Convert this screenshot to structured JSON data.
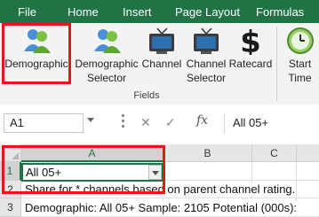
{
  "tabs": [
    "File",
    "Home",
    "Insert",
    "Page Layout",
    "Formulas"
  ],
  "ribbon": {
    "buttons": [
      {
        "line1": "Demographic",
        "line2": "",
        "icon": "demographic-people-icon"
      },
      {
        "line1": "Demographic",
        "line2": "Selector",
        "icon": "demographic-selector-icon"
      },
      {
        "line1": "Channel",
        "line2": "",
        "icon": "tv-channel-icon"
      },
      {
        "line1": "Channel",
        "line2": "Selector",
        "icon": "tv-channel-selector-icon"
      },
      {
        "line1": "Ratecard",
        "line2": "",
        "icon": "dollar-icon"
      },
      {
        "line1": "Start",
        "line2": "Time",
        "icon": "clock-icon"
      }
    ],
    "group_label": "Fields"
  },
  "formula_bar": {
    "name_box": "A1",
    "cancel_symbol": "✕",
    "enter_symbol": "✓",
    "fx_label": "fx",
    "content": "All 05+"
  },
  "grid": {
    "columns": [
      "A",
      "B",
      "C"
    ],
    "rows": [
      {
        "num": "1",
        "text": "All 05+"
      },
      {
        "num": "2",
        "text": "Share for * channels based on parent channel rating."
      },
      {
        "num": "3",
        "text": "Demographic: All 05+  Sample: 2105   Potential (000s): "
      }
    ]
  },
  "colors": {
    "accent": "#217346",
    "highlight": "#e8151b"
  }
}
